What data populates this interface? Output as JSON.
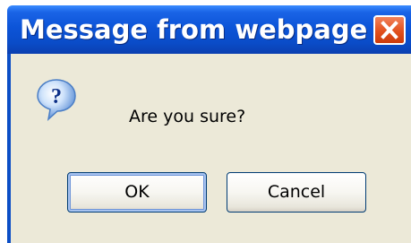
{
  "dialog": {
    "title": "Message from webpage",
    "message": "Are you sure?",
    "icon": "question-icon",
    "close_icon": "close-icon"
  },
  "buttons": {
    "ok_label": "OK",
    "cancel_label": "Cancel"
  },
  "colors": {
    "titlebar": "#0a4cc8",
    "close_button": "#e2501d",
    "dialog_body": "#ece9d8",
    "button_border": "#003c74"
  }
}
